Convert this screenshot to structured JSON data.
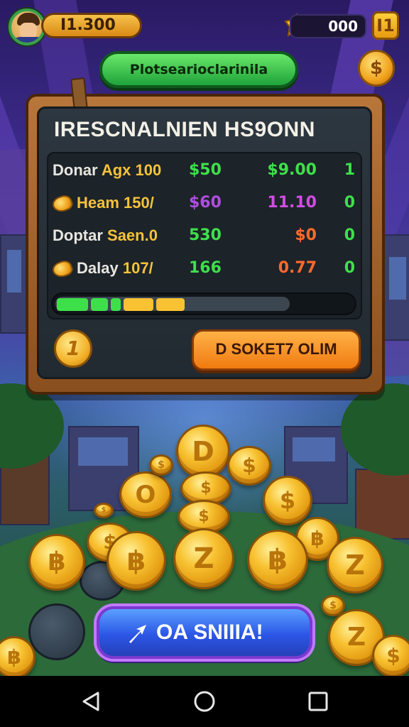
{
  "hud": {
    "score": "I1.300",
    "gems": "000",
    "square_button": "I1",
    "coin_button": "$"
  },
  "banner": {
    "label": "Plotsearioclarinila"
  },
  "board": {
    "title": "IRESCNALNIEN HS9ONN",
    "rows": [
      {
        "name": "Donar",
        "name2": "Agx 100",
        "v1": "$50",
        "v2": "$9.00",
        "v2_color": "#3ee04a",
        "v3": "1",
        "coin": false
      },
      {
        "name": "",
        "name2": "Heam 150/",
        "v1": "$60",
        "v1_color": "#b04ee0",
        "v2": "11.10",
        "v2_color": "#d04ee0",
        "v3": "0",
        "coin": true
      },
      {
        "name": "Doptar",
        "name2": "Saen.0",
        "v1": "530",
        "v2": "$0",
        "v2_color": "#ff6a2a",
        "v3": "0",
        "coin": false
      },
      {
        "name": "Dalay",
        "name2": "107/",
        "v1": "166",
        "v2": "0.77",
        "v2_color": "#ff6a2a",
        "v3": "0",
        "coin": true
      }
    ],
    "progress": 0.45,
    "coin_button": "1",
    "action_button": "D SOKET7 OLIM"
  },
  "cta": {
    "label": "OA SNIIIA!"
  },
  "colors": {
    "green": "#3ee04a",
    "orange": "#f07a10",
    "gold": "#f8c232",
    "board_bg": "#222a31",
    "cta_blue": "#2c56e6"
  },
  "nav": {
    "back": "back-icon",
    "home": "home-icon",
    "recents": "recents-icon"
  }
}
